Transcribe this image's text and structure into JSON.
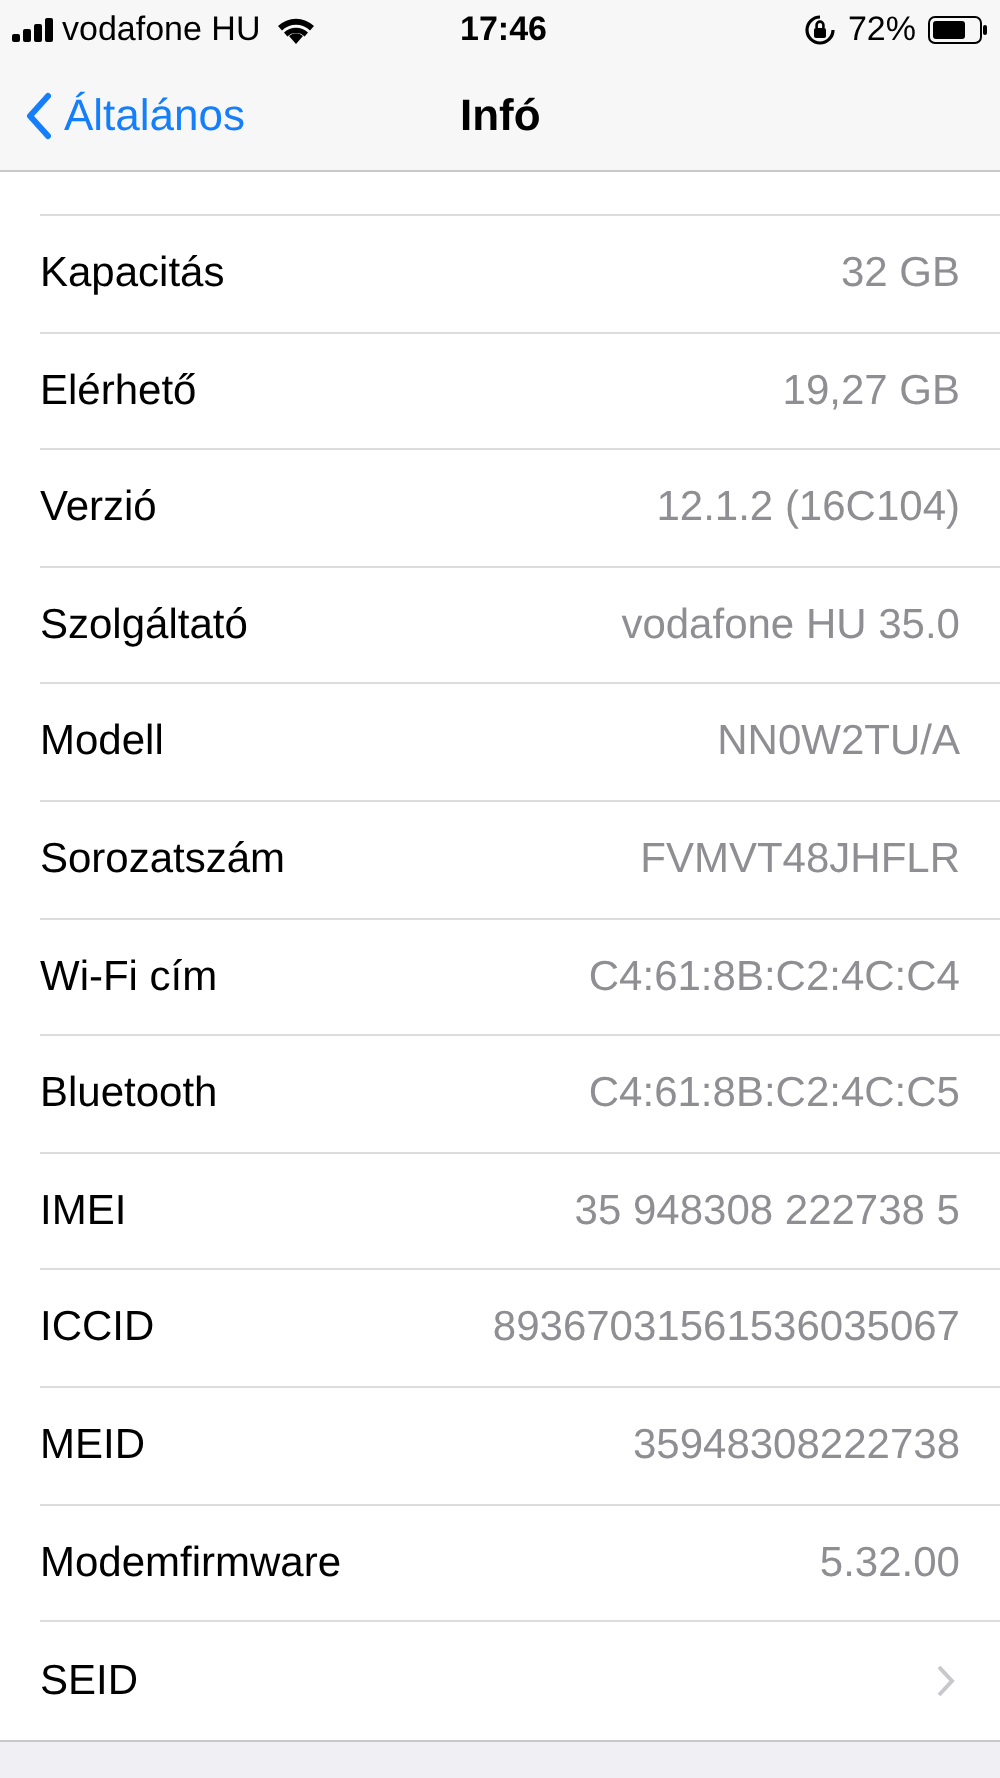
{
  "status_bar": {
    "carrier": "vodafone HU",
    "time": "17:46",
    "battery": "72%"
  },
  "nav": {
    "back": "Általános",
    "title": "Infó"
  },
  "rows": [
    {
      "label": "Kapacitás",
      "value": "32 GB",
      "kind": "info"
    },
    {
      "label": "Elérhető",
      "value": "19,27 GB",
      "kind": "info"
    },
    {
      "label": "Verzió",
      "value": "12.1.2 (16C104)",
      "kind": "info"
    },
    {
      "label": "Szolgáltató",
      "value": "vodafone HU 35.0",
      "kind": "info"
    },
    {
      "label": "Modell",
      "value": "NN0W2TU/A",
      "kind": "info"
    },
    {
      "label": "Sorozatszám",
      "value": "FVMVT48JHFLR",
      "kind": "info"
    },
    {
      "label": "Wi-Fi cím",
      "value": "C4:61:8B:C2:4C:C4",
      "kind": "info"
    },
    {
      "label": "Bluetooth",
      "value": "C4:61:8B:C2:4C:C5",
      "kind": "info"
    },
    {
      "label": "IMEI",
      "value": "35 948308 222738 5",
      "kind": "info"
    },
    {
      "label": "ICCID",
      "value": "89367031561536035067",
      "kind": "info"
    },
    {
      "label": "MEID",
      "value": "35948308222738",
      "kind": "info"
    },
    {
      "label": "Modemfirmware",
      "value": "5.32.00",
      "kind": "info"
    },
    {
      "label": "SEID",
      "kind": "link"
    }
  ]
}
